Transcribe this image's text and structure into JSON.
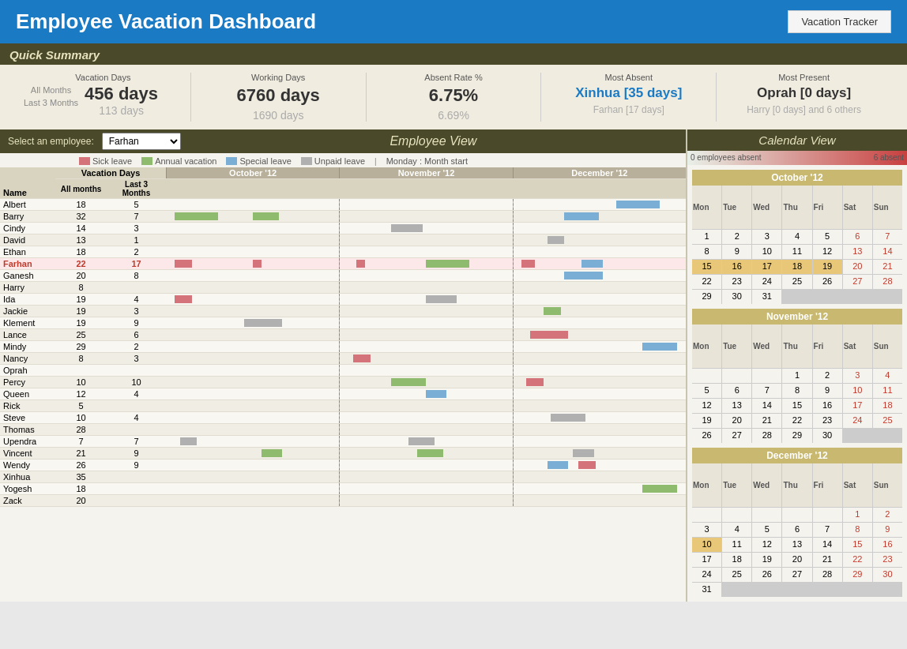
{
  "header": {
    "title": "Employee Vacation Dashboard",
    "tracker_btn": "Vacation Tracker"
  },
  "quick_summary": {
    "label": "Quick Summary",
    "columns": [
      {
        "header": "Vacation Days",
        "all_months_label": "All Months",
        "all_months_val": "456 days",
        "last3_label": "Last 3 Months",
        "last3_val": "113 days"
      },
      {
        "header": "Working Days",
        "all_months_val": "6760 days",
        "last3_val": "1690 days"
      },
      {
        "header": "Absent Rate %",
        "all_months_val": "6.75%",
        "last3_val": "6.69%"
      },
      {
        "header": "Most Absent",
        "all_months_val": "Xinhua [35 days]",
        "last3_val": "Farhan [17 days]"
      },
      {
        "header": "Most Present",
        "all_months_val": "Oprah [0 days]",
        "last3_val": "Harry [0 days] and 6 others"
      }
    ]
  },
  "employee_view": {
    "select_label": "Select an employee:",
    "selected": "Farhan",
    "title": "Employee View",
    "legend": {
      "sick": "Sick leave",
      "annual": "Annual vacation",
      "special": "Special leave",
      "unpaid": "Unpaid leave",
      "note": "Monday : Month start"
    },
    "months": [
      "October '12",
      "November '12",
      "December '12"
    ],
    "col_headers": [
      "Name",
      "All months",
      "Last 3 Months"
    ],
    "employees": [
      {
        "name": "Albert",
        "all": 18,
        "last3": 5
      },
      {
        "name": "Barry",
        "all": 32,
        "last3": 7
      },
      {
        "name": "Cindy",
        "all": 14,
        "last3": 3
      },
      {
        "name": "David",
        "all": 13,
        "last3": 1
      },
      {
        "name": "Ethan",
        "all": 18,
        "last3": 2
      },
      {
        "name": "Farhan",
        "all": 22,
        "last3": 17,
        "selected": true
      },
      {
        "name": "Ganesh",
        "all": 20,
        "last3": 8
      },
      {
        "name": "Harry",
        "all": 8,
        "last3": null
      },
      {
        "name": "Ida",
        "all": 19,
        "last3": 4
      },
      {
        "name": "Jackie",
        "all": 19,
        "last3": 3
      },
      {
        "name": "Klement",
        "all": 19,
        "last3": 9
      },
      {
        "name": "Lance",
        "all": 25,
        "last3": 6
      },
      {
        "name": "Mindy",
        "all": 29,
        "last3": 2
      },
      {
        "name": "Nancy",
        "all": 8,
        "last3": 3
      },
      {
        "name": "Oprah",
        "all": null,
        "last3": null
      },
      {
        "name": "Percy",
        "all": 10,
        "last3": 10
      },
      {
        "name": "Queen",
        "all": 12,
        "last3": 4
      },
      {
        "name": "Rick",
        "all": 5,
        "last3": null
      },
      {
        "name": "Steve",
        "all": 10,
        "last3": 4
      },
      {
        "name": "Thomas",
        "all": 28,
        "last3": null
      },
      {
        "name": "Upendra",
        "all": 7,
        "last3": 7
      },
      {
        "name": "Vincent",
        "all": 21,
        "last3": 9
      },
      {
        "name": "Wendy",
        "all": 26,
        "last3": 9
      },
      {
        "name": "Xinhua",
        "all": 35,
        "last3": null
      },
      {
        "name": "Yogesh",
        "all": 18,
        "last3": null
      },
      {
        "name": "Zack",
        "all": 20,
        "last3": null
      }
    ]
  },
  "calendar_view": {
    "title": "Calendar View",
    "absent_min": "0 employees absent",
    "absent_max": "6 absent",
    "months": [
      {
        "name": "October '12",
        "start_day": 1,
        "days": 31,
        "headers": [
          "Mon",
          "Tue",
          "Wed",
          "Thu",
          "Fri",
          "Sat",
          "Sun"
        ],
        "first_weekday": 1
      },
      {
        "name": "November '12",
        "days": 30,
        "first_weekday": 4
      },
      {
        "name": "December '12",
        "days": 31,
        "first_weekday": 6
      }
    ]
  }
}
